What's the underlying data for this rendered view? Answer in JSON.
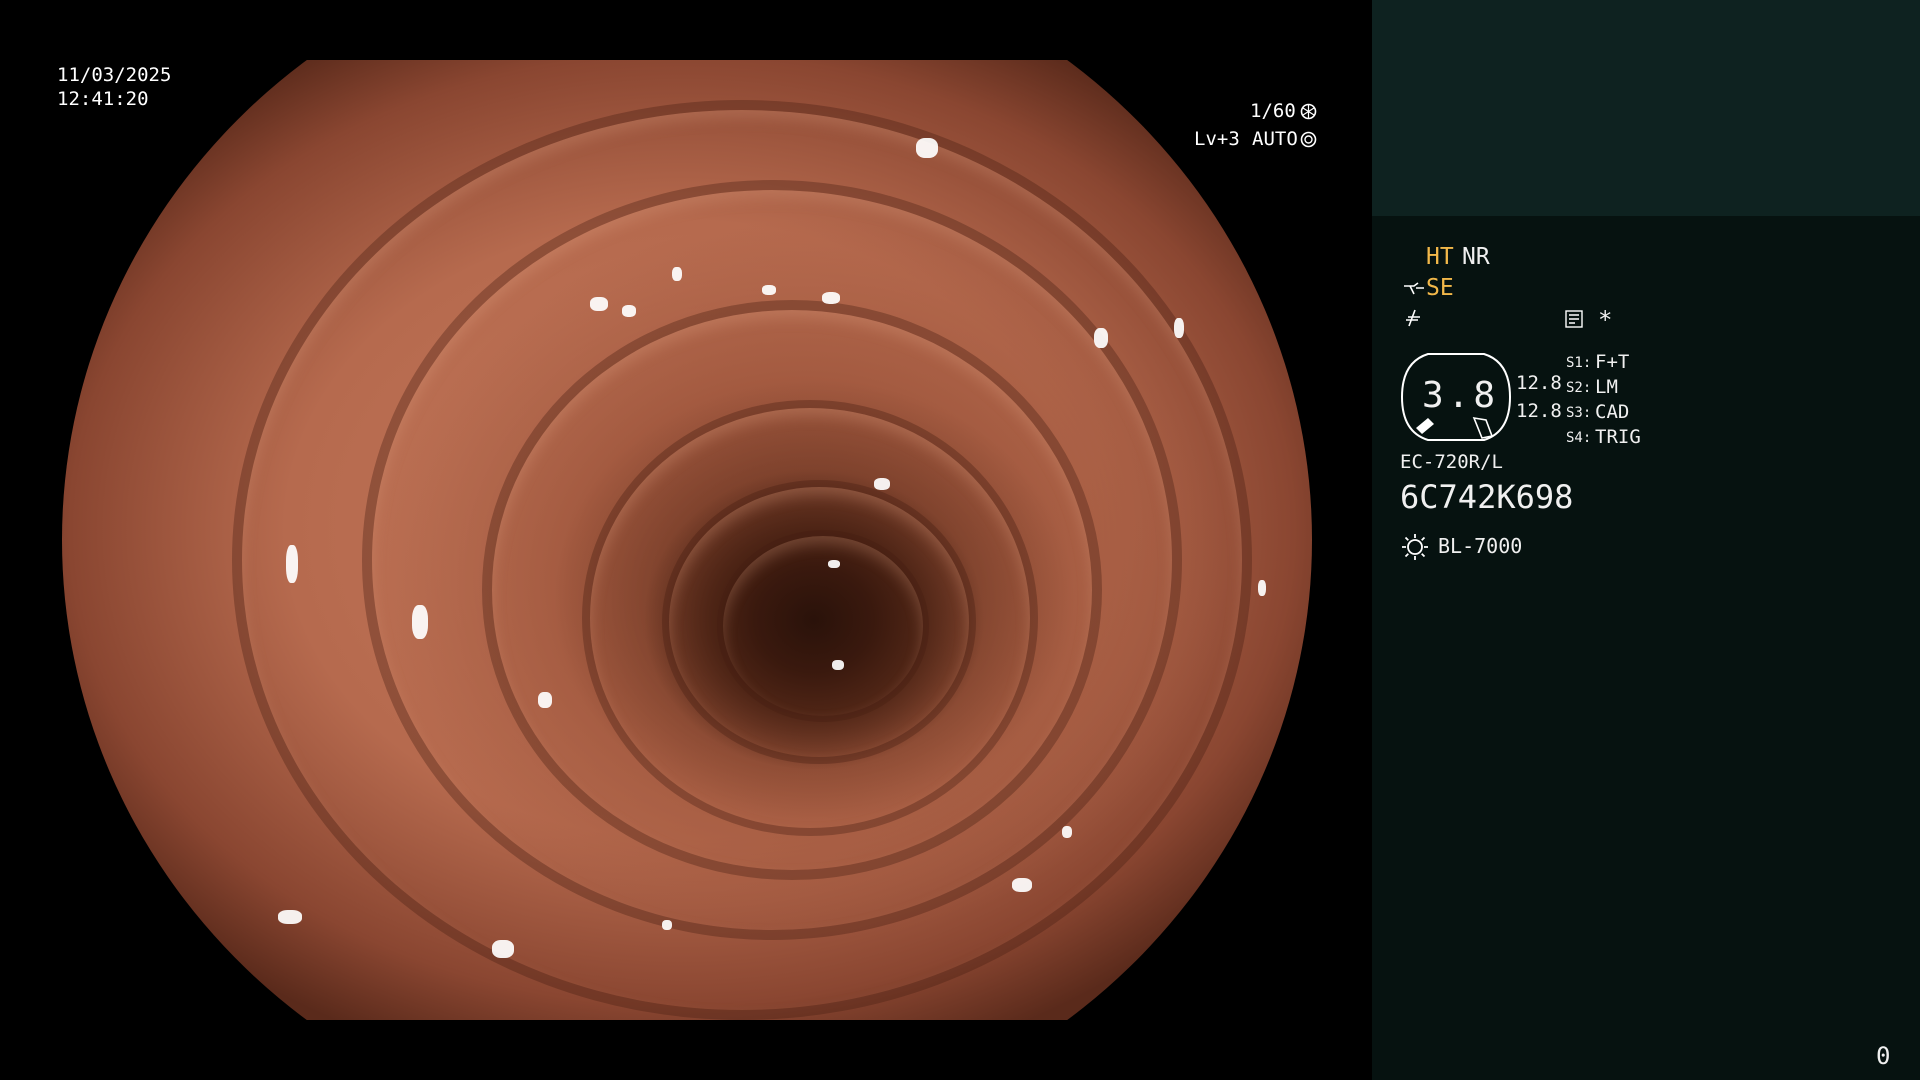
{
  "osd": {
    "date": "11/03/2025",
    "time": "12:41:20",
    "shutter": "1/60",
    "level": "Lv+3",
    "iris": "AUTO"
  },
  "panel": {
    "ht": "HT",
    "nr": "NR",
    "se": "SE",
    "star": "*",
    "zoom": "3.8",
    "val1": "12.8",
    "val2": "12.8",
    "switches": [
      {
        "key": "S1:",
        "value": "F+T"
      },
      {
        "key": "S2:",
        "value": "LM"
      },
      {
        "key": "S3:",
        "value": "CAD"
      },
      {
        "key": "S4:",
        "value": "TRIG"
      }
    ],
    "scope_model": "EC-720R/L",
    "serial": "6C742K698",
    "light_source": "BL-7000",
    "counter": "0"
  },
  "colors": {
    "panel_bg": "#061210",
    "panel_top_bg": "#0e2220",
    "amber": "#f2b84a"
  },
  "icons": [
    "shutter-icon",
    "iris-icon",
    "enhance-icon",
    "filter-icon",
    "memo-icon",
    "zoom-dial-icon",
    "light-source-icon"
  ]
}
